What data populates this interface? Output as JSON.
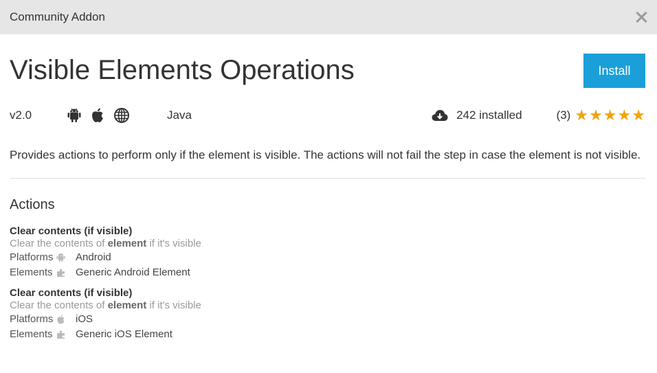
{
  "window": {
    "title": "Community Addon"
  },
  "addon": {
    "title": "Visible Elements Operations",
    "install_label": "Install",
    "version": "v2.0",
    "platform_icons": [
      "android-icon",
      "apple-icon",
      "globe-icon"
    ],
    "language": "Java",
    "installed_text": "242 installed",
    "rating_count": "(3)",
    "rating_stars": 5,
    "description": "Provides actions to perform only if the element is visible. The actions will not fail the step in case the element is not visible."
  },
  "actions_section": {
    "title": "Actions",
    "platforms_label": "Platforms",
    "elements_label": "Elements",
    "items": [
      {
        "title": "Clear contents (if visible)",
        "desc_prefix": "Clear the contents of ",
        "desc_bold": "element",
        "desc_suffix": " if it's visible",
        "platform": "Android",
        "element": "Generic Android Element"
      },
      {
        "title": "Clear contents (if visible)",
        "desc_prefix": "Clear the contents of ",
        "desc_bold": "element",
        "desc_suffix": " if it's visible",
        "platform": "iOS",
        "element": "Generic iOS Element"
      }
    ]
  },
  "colors": {
    "accent": "#1a9fd9",
    "star": "#f0a30a",
    "titlebar": "#e6e6e6"
  }
}
